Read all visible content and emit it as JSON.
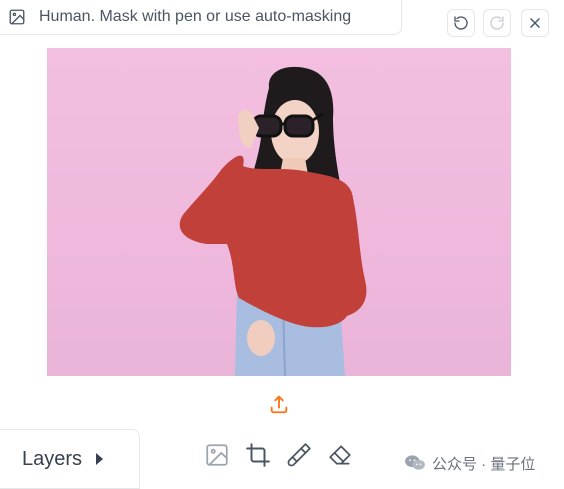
{
  "editor": {
    "label": "Human. Mask with pen or use auto-masking",
    "label_icon": "image-icon",
    "controls": {
      "undo_icon": "undo-icon",
      "redo_icon": "redo-icon",
      "close_icon": "close-icon"
    },
    "upload_icon": "upload-icon"
  },
  "layers": {
    "label": "Layers"
  },
  "toolbar": {
    "tools": [
      {
        "name": "image-tool",
        "icon": "image-icon"
      },
      {
        "name": "crop-tool",
        "icon": "crop-icon"
      },
      {
        "name": "brush-tool",
        "icon": "brush-icon"
      },
      {
        "name": "eraser-tool",
        "icon": "eraser-icon"
      }
    ]
  },
  "watermark": {
    "text": "公众号 · 量子位"
  },
  "colors": {
    "accent": "#f97316",
    "mask": "#c1403a",
    "background": "#f0bbde"
  }
}
